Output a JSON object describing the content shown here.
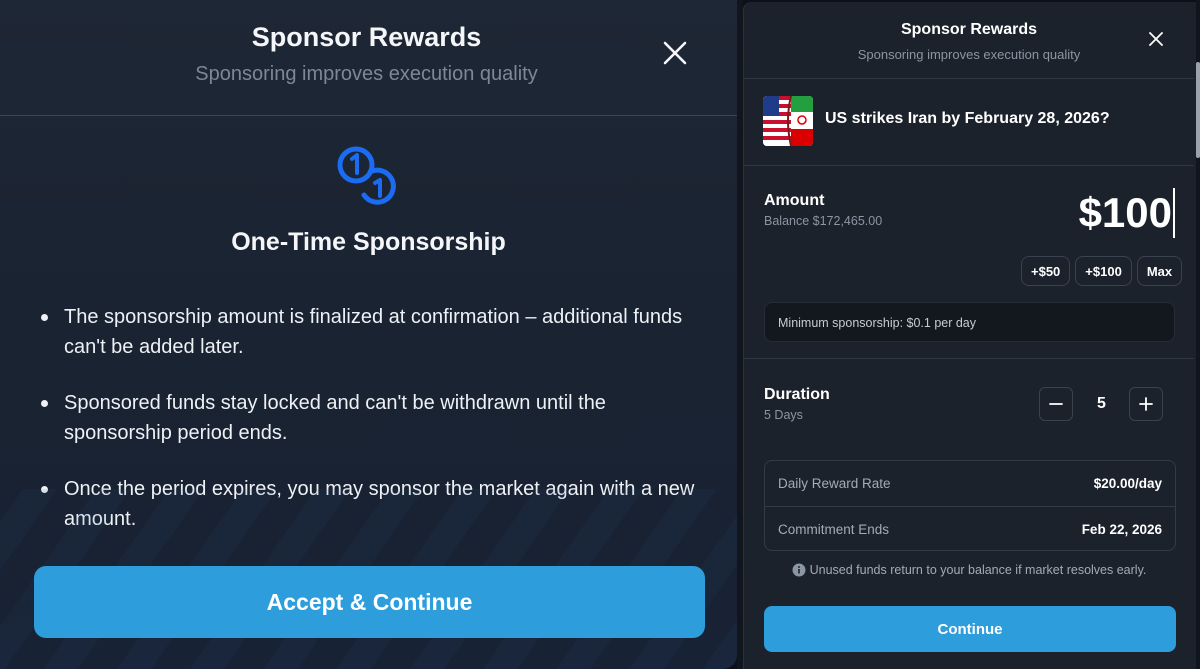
{
  "left_modal": {
    "title": "Sponsor Rewards",
    "subtitle": "Sponsoring improves execution quality",
    "heading": "One-Time Sponsorship",
    "bullets": [
      "The sponsorship amount is finalized at confirmation – additional funds can't be added later.",
      "Sponsored funds stay locked and can't be withdrawn until the sponsorship period ends.",
      "Once the period expires, you may sponsor the market again with a new amount."
    ],
    "accept_label": "Accept & Continue",
    "icon": "coins-icon",
    "close_icon": "close-icon"
  },
  "right_modal": {
    "title": "Sponsor Rewards",
    "subtitle": "Sponsoring improves execution quality",
    "market": {
      "question": "US strikes Iran by February 28, 2026?",
      "image": "us-iran-flags"
    },
    "amount": {
      "label": "Amount",
      "balance": "Balance $172,465.00",
      "value": "$100",
      "quick_buttons": [
        "+$50",
        "+$100",
        "Max"
      ],
      "minimum_note": "Minimum sponsorship: $0.1 per day"
    },
    "duration": {
      "label": "Duration",
      "days_text": "5 Days",
      "value": "5"
    },
    "summary": [
      {
        "label": "Daily Reward Rate",
        "value": "$20.00/day"
      },
      {
        "label": "Commitment Ends",
        "value": "Feb 22, 2026"
      }
    ],
    "note": "Unused funds return to your balance if market resolves early.",
    "continue_label": "Continue"
  },
  "colors": {
    "accent": "#2d9ddc",
    "coin_icon": "#1b6cf2",
    "left_bg": "#1e2735",
    "right_bg": "#1c222b"
  }
}
